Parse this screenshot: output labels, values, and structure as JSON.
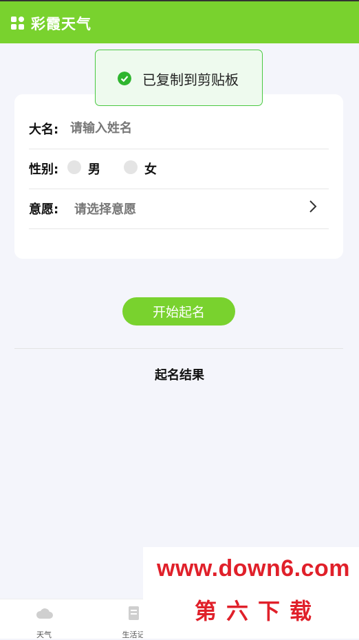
{
  "header": {
    "title": "彩霞天气",
    "icon": "grid-apps-icon"
  },
  "toast": {
    "message": "已复制到剪贴板",
    "icon": "check-circle-icon",
    "color": "#2fb52f"
  },
  "form": {
    "name_label": "大名:",
    "name_placeholder": "请输入姓名",
    "gender_label": "性别:",
    "gender_options": [
      "男",
      "女"
    ],
    "wish_label": "意愿:",
    "wish_placeholder": "请选择意愿"
  },
  "start_button": "开始起名",
  "result_title": "起名结果",
  "tabbar": {
    "tabs": [
      {
        "label": "天气",
        "icon": "cloud-icon"
      },
      {
        "label": "生活记",
        "icon": "receipt-icon"
      }
    ]
  },
  "watermark": {
    "url": "www.down6.com",
    "text": "第六下载"
  },
  "colors": {
    "accent": "#79d22e",
    "background": "#f4f5fb",
    "watermark": "#e0202a"
  }
}
